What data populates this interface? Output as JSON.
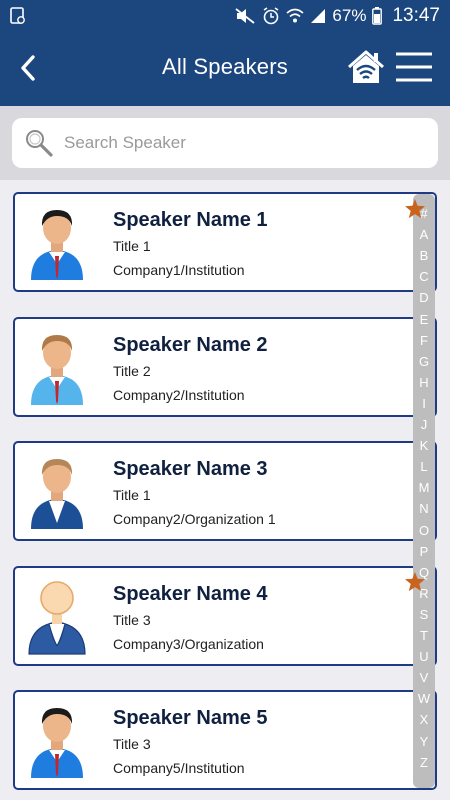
{
  "status_bar": {
    "battery_percent": "67%",
    "time": "13:47",
    "icons": [
      "sim-card-icon",
      "mute-icon",
      "alarm-icon",
      "wifi-icon",
      "signal-icon",
      "battery-icon"
    ]
  },
  "app_bar": {
    "title": "All Speakers",
    "back_icon": "chevron-left-icon",
    "home_icon": "home-wifi-icon",
    "menu_icon": "hamburger-menu-icon"
  },
  "search": {
    "placeholder": "Search Speaker",
    "value": ""
  },
  "speakers": [
    {
      "name": "Speaker Name 1",
      "title": "Title 1",
      "company": "Company1/Institution",
      "favorite": true,
      "avatar": "man-blue-shirt-red-tie-black-hair"
    },
    {
      "name": "Speaker Name 2",
      "title": "Title 2",
      "company": "Company2/Institution",
      "favorite": false,
      "avatar": "man-light-blue-shirt-red-tie-brown-hair"
    },
    {
      "name": "Speaker Name 3",
      "title": "Title 1",
      "company": "Company2/Organization 1",
      "favorite": false,
      "avatar": "man-dark-suit-white-shirt"
    },
    {
      "name": "Speaker Name 4",
      "title": "Title 3",
      "company": "Company3/Organization",
      "favorite": true,
      "avatar": "placeholder-person-blue-suit"
    },
    {
      "name": "Speaker Name 5",
      "title": "Title 3",
      "company": "Company5/Institution",
      "favorite": false,
      "avatar": "man-blue-shirt-red-tie-black-hair"
    }
  ],
  "alphabet_index": [
    "#",
    "A",
    "B",
    "C",
    "D",
    "E",
    "F",
    "G",
    "H",
    "I",
    "J",
    "K",
    "L",
    "M",
    "N",
    "O",
    "P",
    "Q",
    "R",
    "S",
    "T",
    "U",
    "V",
    "W",
    "X",
    "Y",
    "Z"
  ],
  "colors": {
    "primary": "#1c467e",
    "card_border": "#1f3b86",
    "star": "#c8641e",
    "index_bg": "#bdbdbd",
    "background": "#eeeef2"
  }
}
